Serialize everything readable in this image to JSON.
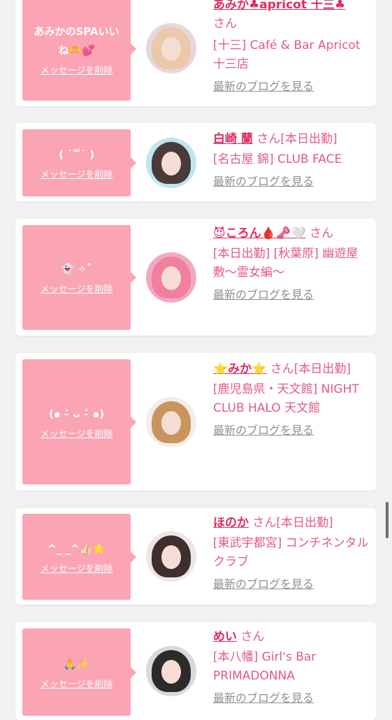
{
  "messages": [
    {
      "bubble_text": "あみかのSPAいいね🫶💕",
      "delete_label": "メッセージを削除",
      "name": "あみか♣apricot 十三♣",
      "san": "さん",
      "shop": "[十三] Café & Bar Apricot 十三店",
      "blog_label": "最新のブログを見る",
      "avatar_colors": {
        "bg": "#e7d6dc",
        "hair": "#e9c9a8"
      }
    },
    {
      "bubble_text": "( ˙꒳˙ )",
      "delete_label": "メッセージを削除",
      "name": "白崎 蘭",
      "san": "さん[本日出勤]",
      "shop": "[名古屋 錦] CLUB FACE",
      "blog_label": "最新のブログを見る",
      "avatar_colors": {
        "bg": "#bfe6ee",
        "hair": "#4a3a3a"
      }
    },
    {
      "bubble_text": "👻 ✧˚",
      "delete_label": "メッセージを削除",
      "name": "😈ころん🩸🗝🤍",
      "san": "さん",
      "shop": "[本日出勤] [秋葉原] 幽遊屋敷〜霊女編〜",
      "blog_label": "最新のブログを見る",
      "avatar_colors": {
        "bg": "#f2a9bf",
        "hair": "#f07fa0"
      }
    },
    {
      "bubble_text": "(๑ ˃̵ ᴗ ˂̵ ๑)",
      "delete_label": "メッセージを削除",
      "name": "⭐️みか⭐️",
      "san": "さん[本日出勤]",
      "shop": "[鹿児島県・天文館] NIGHT CLUB HALO 天文館",
      "blog_label": "最新のブログを見る",
      "avatar_colors": {
        "bg": "#f4ece6",
        "hair": "#c9955e"
      }
    },
    {
      "bubble_text": "^_ _^👍🏻⭐️",
      "delete_label": "メッセージを削除",
      "name": "ほのか",
      "san": "さん[本日出勤]",
      "shop": "[東武宇都宮] コンチネンタルクラブ",
      "blog_label": "最新のブログを見る",
      "avatar_colors": {
        "bg": "#efe4e6",
        "hair": "#3e2f2f"
      }
    },
    {
      "bubble_text": "🙏✨",
      "delete_label": "メッセージを削除",
      "name": "めい",
      "san": "さん",
      "shop": "[本八幡] Girl's Bar PRIMADONNA",
      "blog_label": "最新のブログを見る",
      "avatar_colors": {
        "bg": "#d9d9d9",
        "hair": "#2b2b2b"
      }
    }
  ]
}
